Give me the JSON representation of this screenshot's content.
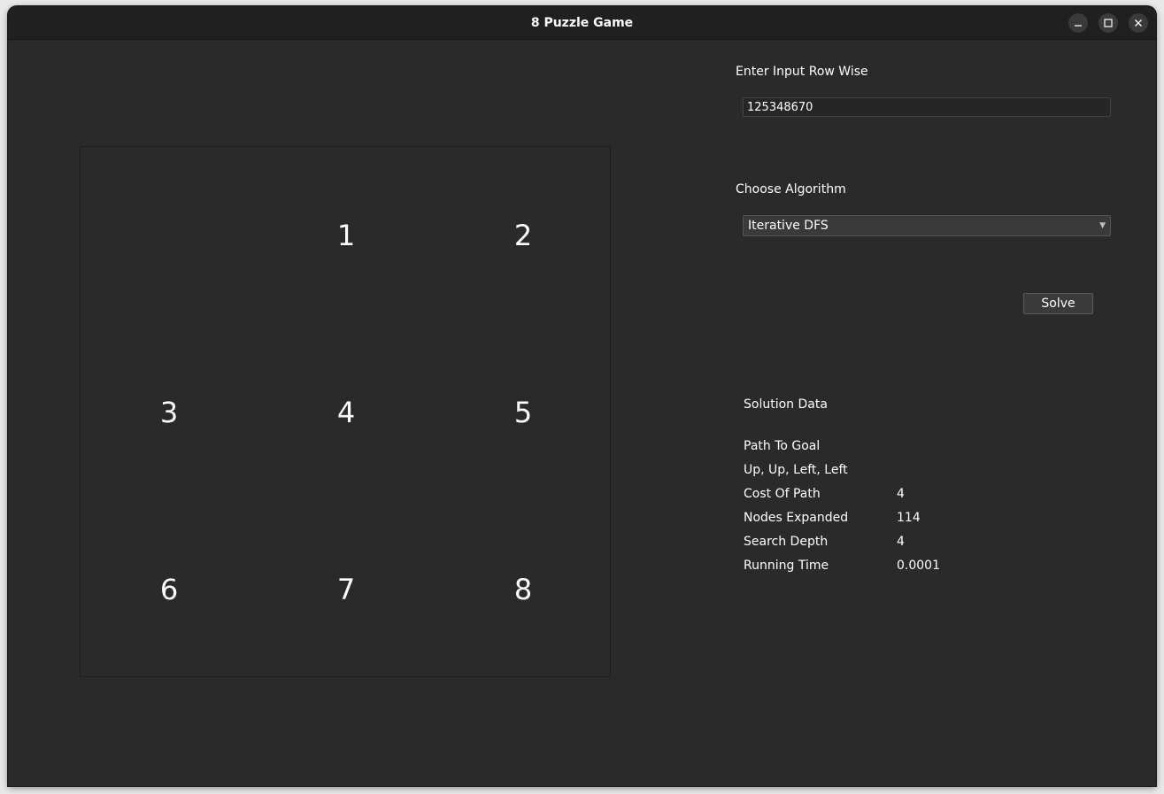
{
  "window": {
    "title": "8 Puzzle Game",
    "controls": [
      "minimize",
      "maximize",
      "close"
    ]
  },
  "board": {
    "tiles": [
      [
        "",
        "1",
        "2"
      ],
      [
        "3",
        "4",
        "5"
      ],
      [
        "6",
        "7",
        "8"
      ]
    ]
  },
  "input": {
    "label": "Enter Input Row Wise",
    "value": "125348670"
  },
  "algorithm": {
    "label": "Choose Algorithm",
    "selected": "Iterative DFS"
  },
  "solve_button": {
    "label": "Solve"
  },
  "solution": {
    "title": "Solution Data",
    "path_label": "Path To Goal",
    "path_value": "Up, Up, Left, Left",
    "stats": [
      {
        "label": "Cost Of Path",
        "value": "4"
      },
      {
        "label": "Nodes Expanded",
        "value": "114"
      },
      {
        "label": "Search Depth",
        "value": "4"
      },
      {
        "label": "Running Time",
        "value": "0.0001"
      }
    ]
  }
}
